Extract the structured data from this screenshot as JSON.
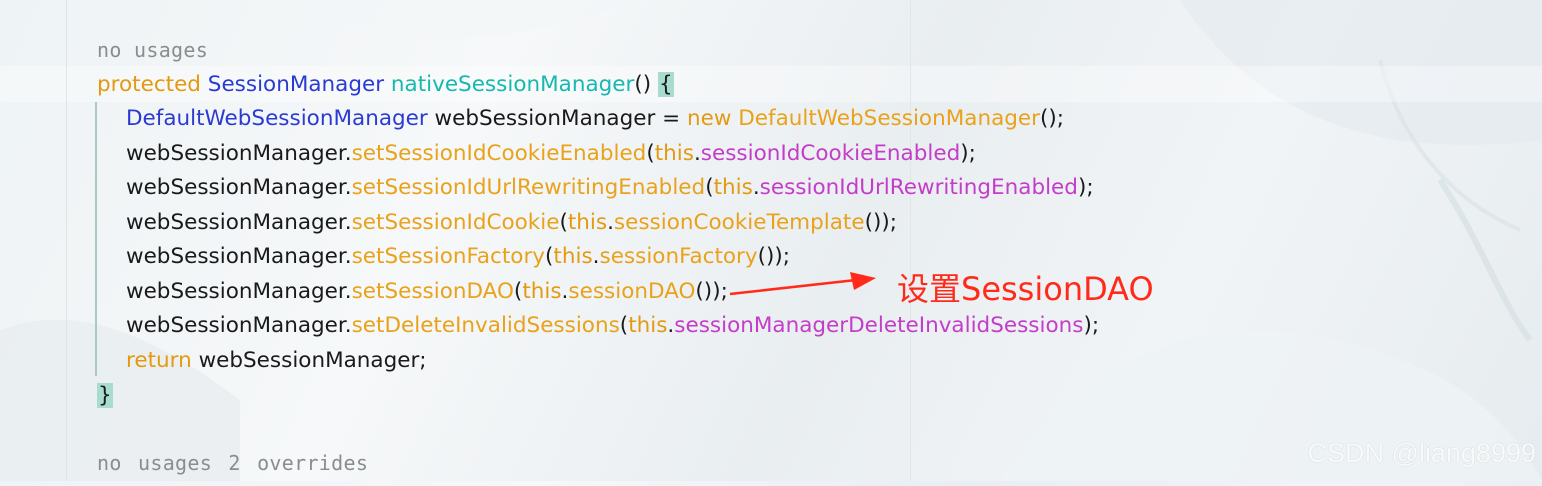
{
  "editor": {
    "inlay_top": "no usages",
    "inlay_bottom": "no usages  2 overrides",
    "lines": [
      [
        {
          "t": "protected ",
          "c": "kw"
        },
        {
          "t": "SessionManager ",
          "c": "type"
        },
        {
          "t": "nativeSessionManager",
          "c": "decl"
        },
        {
          "t": "() ",
          "c": "plain"
        },
        {
          "t": "{",
          "c": "brace-hl"
        }
      ],
      [
        {
          "t": "DefaultWebSessionManager ",
          "c": "type"
        },
        {
          "t": "webSessionManager = ",
          "c": "plain"
        },
        {
          "t": "new ",
          "c": "kw"
        },
        {
          "t": "DefaultWebSessionManager",
          "c": "method"
        },
        {
          "t": "();",
          "c": "plain"
        }
      ],
      [
        {
          "t": "webSessionManager.",
          "c": "plain"
        },
        {
          "t": "setSessionIdCookieEnabled",
          "c": "method"
        },
        {
          "t": "(",
          "c": "plain"
        },
        {
          "t": "this",
          "c": "kw"
        },
        {
          "t": ".",
          "c": "plain"
        },
        {
          "t": "sessionIdCookieEnabled",
          "c": "field"
        },
        {
          "t": ");",
          "c": "plain"
        }
      ],
      [
        {
          "t": "webSessionManager.",
          "c": "plain"
        },
        {
          "t": "setSessionIdUrlRewritingEnabled",
          "c": "method"
        },
        {
          "t": "(",
          "c": "plain"
        },
        {
          "t": "this",
          "c": "kw"
        },
        {
          "t": ".",
          "c": "plain"
        },
        {
          "t": "sessionIdUrlRewritingEnabled",
          "c": "field"
        },
        {
          "t": ");",
          "c": "plain"
        }
      ],
      [
        {
          "t": "webSessionManager.",
          "c": "plain"
        },
        {
          "t": "setSessionIdCookie",
          "c": "method"
        },
        {
          "t": "(",
          "c": "plain"
        },
        {
          "t": "this",
          "c": "kw"
        },
        {
          "t": ".",
          "c": "plain"
        },
        {
          "t": "sessionCookieTemplate",
          "c": "method"
        },
        {
          "t": "());",
          "c": "plain"
        }
      ],
      [
        {
          "t": "webSessionManager.",
          "c": "plain"
        },
        {
          "t": "setSessionFactory",
          "c": "method"
        },
        {
          "t": "(",
          "c": "plain"
        },
        {
          "t": "this",
          "c": "kw"
        },
        {
          "t": ".",
          "c": "plain"
        },
        {
          "t": "sessionFactory",
          "c": "method"
        },
        {
          "t": "());",
          "c": "plain"
        }
      ],
      [
        {
          "t": "webSessionManager.",
          "c": "plain"
        },
        {
          "t": "setSessionDAO",
          "c": "method"
        },
        {
          "t": "(",
          "c": "plain"
        },
        {
          "t": "this",
          "c": "kw"
        },
        {
          "t": ".",
          "c": "plain"
        },
        {
          "t": "sessionDAO",
          "c": "method"
        },
        {
          "t": "());",
          "c": "plain"
        }
      ],
      [
        {
          "t": "webSessionManager.",
          "c": "plain"
        },
        {
          "t": "setDeleteInvalidSessions",
          "c": "method"
        },
        {
          "t": "(",
          "c": "plain"
        },
        {
          "t": "this",
          "c": "kw"
        },
        {
          "t": ".",
          "c": "plain"
        },
        {
          "t": "sessionManagerDeleteInvalidSessions",
          "c": "field"
        },
        {
          "t": ");",
          "c": "plain"
        }
      ],
      [
        {
          "t": "return ",
          "c": "kw"
        },
        {
          "t": "webSessionManager;",
          "c": "plain"
        }
      ],
      [
        {
          "t": "}",
          "c": "brace-hl"
        }
      ]
    ]
  },
  "annotation": {
    "text": "设置SessionDAO",
    "color": "#ff2a1a"
  },
  "watermark": "CSDN @liang8999",
  "colors": {
    "keyword": "#e39a10",
    "type": "#2b3bd1",
    "declaration": "#17b8b0",
    "method": "#e9a21a",
    "field": "#c43cc9"
  }
}
